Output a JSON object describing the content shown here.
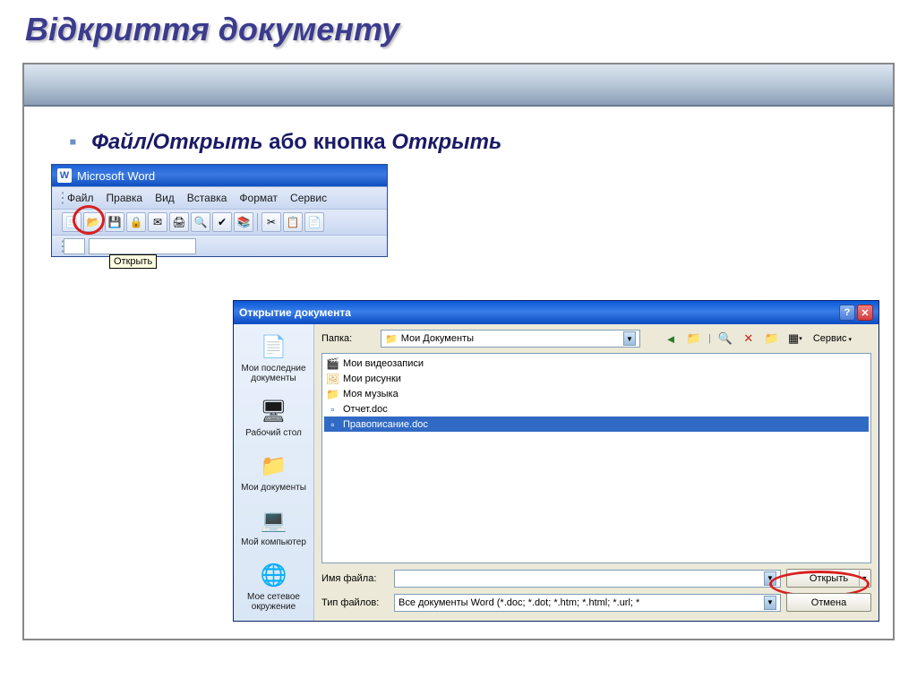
{
  "slide": {
    "title": "Відкриття документу",
    "instruction_strong": "Файл/Открыть",
    "instruction_rest_1": " або кнопка ",
    "instruction_italic": "Открыть"
  },
  "word": {
    "app_title": "Microsoft Word",
    "menu": {
      "file": "Файл",
      "edit": "Правка",
      "view": "Вид",
      "insert": "Вставка",
      "format": "Формат",
      "tools": "Сервис"
    },
    "tooltip_open": "Открыть"
  },
  "dialog": {
    "title": "Открытие документа",
    "folder_label": "Папка:",
    "folder_value": "Мои Документы",
    "service_label": "Сервис",
    "places": {
      "recent": "Мои последние документы",
      "desktop": "Рабочий стол",
      "mydocs": "Мои документы",
      "mycomp": "Мой компьютер",
      "network": "Мое сетевое окружение"
    },
    "files": {
      "videos": "Мои видеозаписи",
      "pictures": "Мои рисунки",
      "music": "Моя музыка",
      "report": "Отчет.doc",
      "spelling": "Правописание.doc"
    },
    "filename_label": "Имя файла:",
    "filetype_label": "Тип файлов:",
    "filetype_value": "Все документы Word (*.doc; *.dot; *.htm; *.html; *.url; *",
    "open_button": "Открыть",
    "cancel_button": "Отмена"
  }
}
